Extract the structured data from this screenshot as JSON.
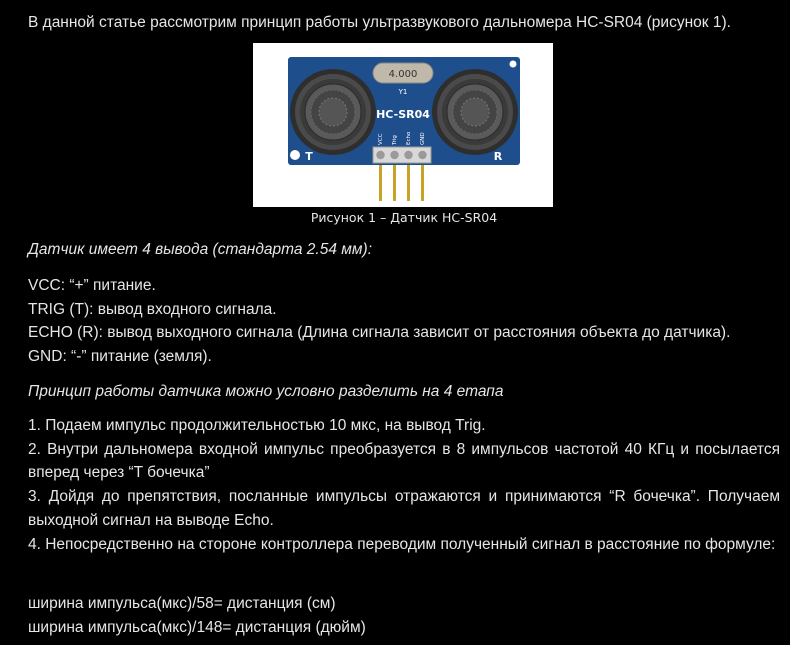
{
  "article": {
    "intro": "В данной статье рассмотрим принцип работы ультразвукового дальномера HC-SR04 (рисунок 1).",
    "figure": {
      "caption": "Рисунок 1 – Датчик HC-SR04",
      "crystal_label": "4.000",
      "crystal_ref": "Y1",
      "board_label": "HC-SR04",
      "left_label": "T",
      "right_label": "R",
      "pin_labels": [
        "VCC",
        "Trig",
        "Echo",
        "GND"
      ],
      "board_color": "#1f4e8c"
    },
    "pins_intro": "Датчик имеет 4 вывода (стандарта 2.54 мм):",
    "pins": [
      "VCC: “+” питание.",
      "TRIG (T): вывод входного сигнала.",
      "ECHO (R): вывод выходного сигнала (Длина сигнала зависит от расстояния объекта до датчика).",
      "GND: “-” питание (земля)."
    ],
    "principle_intro": "Принцип работы датчика можно условно разделить на 4 етапа",
    "steps": [
      "1. Подаем импульс продолжительностью 10 мкс, на вывод Trig.",
      "2. Внутри дальномера входной импульс преобразуется в 8 импульсов частотой 40 КГц и посылается вперед через “T бочечка”",
      "3. Дойдя до препятствия, посланные импульсы отражаются и принимаются “R бочечка”. Получаем выходной сигнал на выводе Echo.",
      "4. Непосредственно на стороне контроллера переводим полученный сигнал в расстояние по формуле:"
    ],
    "formulas": [
      "ширина импульса(мкс)/58= дистанция (см)",
      "ширина импульса(мкс)/148= дистанция (дюйм)"
    ]
  }
}
